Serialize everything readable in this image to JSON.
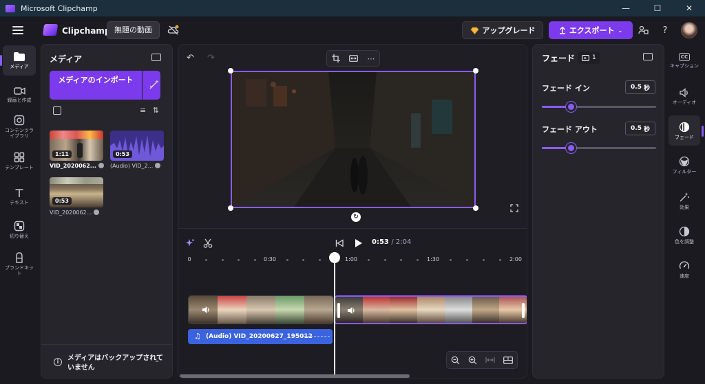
{
  "window": {
    "title": "Microsoft Clipchamp",
    "minimize": "—",
    "maximize": "☐",
    "close": "✕"
  },
  "header": {
    "brand": "Clipchamp",
    "project_title": "無題の動画",
    "upgrade_label": "アップグレード",
    "export_label": "エクスポート",
    "help": "?"
  },
  "left_nav": [
    {
      "label": "メディア",
      "icon": "folder-icon"
    },
    {
      "label": "録画と作成",
      "icon": "video-camera-icon"
    },
    {
      "label": "コンテンツライブラリ",
      "icon": "library-icon"
    },
    {
      "label": "テンプレート",
      "icon": "templates-icon"
    },
    {
      "label": "テキスト",
      "icon": "text-icon"
    },
    {
      "label": "切り替え",
      "icon": "transitions-icon"
    },
    {
      "label": "ブランドキット",
      "icon": "brand-kit-icon"
    }
  ],
  "media_panel": {
    "title": "メディア",
    "import_label": "メディアのインポート",
    "items": [
      {
        "duration": "1:11",
        "label": "VID_2020062...",
        "bold": true
      },
      {
        "duration": "0:53",
        "label": "(Audio) VID_2...",
        "bold": false
      },
      {
        "duration": "0:53",
        "label": "VID_2020062...",
        "bold": false
      }
    ],
    "backup_text": "メディアはバックアップされていません",
    "backup_info": "i"
  },
  "preview": {
    "undo": "↶",
    "redo": "↷"
  },
  "timeline": {
    "current_time": "0:53",
    "total_time": "/ 2:04",
    "ruler_labels": [
      "0",
      "0:30",
      "1:00",
      "1:30",
      "2:00"
    ],
    "audio_clip_label": "(Audio) VID_20200627_195012"
  },
  "fade_panel": {
    "title": "フェード",
    "clip_count": "1",
    "fade_in": {
      "label": "フェード イン",
      "value": "0.5",
      "unit": "秒",
      "fraction": 0.25
    },
    "fade_out": {
      "label": "フェード アウト",
      "value": "0.5",
      "unit": "秒",
      "fraction": 0.25
    }
  },
  "right_nav": [
    {
      "label": "キャプション",
      "icon": "captions-icon",
      "glyph": "CC"
    },
    {
      "label": "オーディオ",
      "icon": "speaker-icon"
    },
    {
      "label": "フェード",
      "icon": "fade-icon"
    },
    {
      "label": "フィルター",
      "icon": "filter-icon"
    },
    {
      "label": "効果",
      "icon": "effects-icon"
    },
    {
      "label": "色を調整",
      "icon": "color-adjust-icon"
    },
    {
      "label": "速度",
      "icon": "speed-icon"
    }
  ],
  "colors": {
    "accent": "#7c3aed",
    "audio_track": "#3b63e0",
    "background": "#1b1a20"
  }
}
